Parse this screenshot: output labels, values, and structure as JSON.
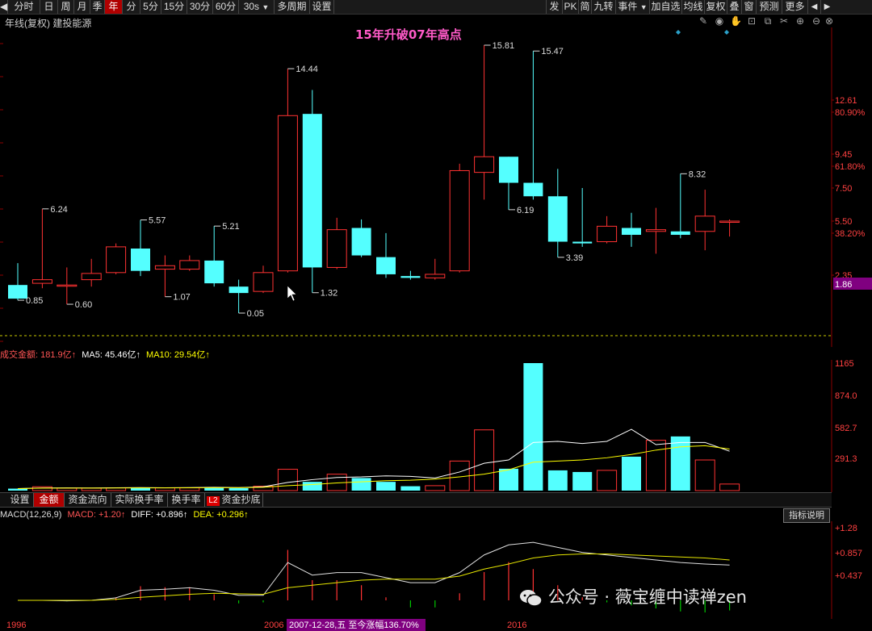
{
  "toolbar": {
    "left_items": [
      "分时",
      "日",
      "周",
      "月",
      "季",
      "年",
      "分",
      "5分",
      "15分",
      "30分",
      "60分",
      "30s",
      "多周期",
      "设置"
    ],
    "active": "年",
    "right_items": [
      "发",
      "PK",
      "简",
      "九转",
      "事件",
      "加自选",
      "均线",
      "复权",
      "叠",
      "窗",
      "预测",
      "更多"
    ]
  },
  "header": {
    "subtitle": "年线(复权) 建投能源",
    "headline": "15年升破07年高点"
  },
  "price_axis": {
    "labels": [
      "12.61",
      "80.90%",
      "9.45",
      "61.80%",
      "7.50",
      "5.50",
      "38.20%",
      "2.35",
      "1.86"
    ],
    "current": "1.86"
  },
  "chart_data": {
    "type": "candlestick",
    "candles": [
      {
        "o": 1.8,
        "c": 0.95,
        "h": 3.05,
        "l": 0.85
      },
      {
        "o": 1.9,
        "c": 2.1,
        "h": 6.24,
        "l": 1.6
      },
      {
        "o": 1.8,
        "c": 1.8,
        "h": 2.8,
        "l": 0.6
      },
      {
        "o": 2.1,
        "c": 2.45,
        "h": 3.3,
        "l": 1.7
      },
      {
        "o": 2.5,
        "c": 4.0,
        "h": 4.2,
        "l": 2.4
      },
      {
        "o": 3.9,
        "c": 2.6,
        "h": 5.57,
        "l": 2.3
      },
      {
        "o": 2.7,
        "c": 2.9,
        "h": 3.5,
        "l": 1.07
      },
      {
        "o": 2.7,
        "c": 3.2,
        "h": 3.5,
        "l": 2.6
      },
      {
        "o": 3.2,
        "c": 1.9,
        "h": 5.21,
        "l": 1.7
      },
      {
        "o": 1.7,
        "c": 1.3,
        "h": 2.1,
        "l": 0.05
      },
      {
        "o": 1.4,
        "c": 2.5,
        "h": 2.9,
        "l": 1.3
      },
      {
        "o": 2.6,
        "c": 11.7,
        "h": 14.44,
        "l": 2.5
      },
      {
        "o": 11.8,
        "c": 2.8,
        "h": 13.2,
        "l": 1.32
      },
      {
        "o": 2.8,
        "c": 5.0,
        "h": 5.7,
        "l": 2.7
      },
      {
        "o": 5.1,
        "c": 3.5,
        "h": 5.6,
        "l": 3.4
      },
      {
        "o": 3.4,
        "c": 2.4,
        "h": 4.8,
        "l": 2.2
      },
      {
        "o": 2.3,
        "c": 2.2,
        "h": 2.6,
        "l": 2.1
      },
      {
        "o": 2.2,
        "c": 2.4,
        "h": 3.3,
        "l": 2.1
      },
      {
        "o": 2.6,
        "c": 8.5,
        "h": 8.9,
        "l": 2.5
      },
      {
        "o": 8.4,
        "c": 9.3,
        "h": 15.81,
        "l": 6.8
      },
      {
        "o": 9.3,
        "c": 7.8,
        "h": 9.3,
        "l": 6.19
      },
      {
        "o": 7.8,
        "c": 7.0,
        "h": 15.47,
        "l": 6.8
      },
      {
        "o": 7.0,
        "c": 4.3,
        "h": 8.6,
        "l": 3.39
      },
      {
        "o": 4.3,
        "c": 4.2,
        "h": 7.5,
        "l": 4.0
      },
      {
        "o": 4.3,
        "c": 5.2,
        "h": 5.8,
        "l": 4.2
      },
      {
        "o": 5.1,
        "c": 4.7,
        "h": 6.0,
        "l": 4.0
      },
      {
        "o": 4.9,
        "c": 5.0,
        "h": 6.3,
        "l": 3.6
      },
      {
        "o": 4.9,
        "c": 4.7,
        "h": 8.32,
        "l": 4.5
      },
      {
        "o": 4.9,
        "c": 5.8,
        "h": 7.4,
        "l": 3.8
      },
      {
        "o": 5.5,
        "c": 5.5,
        "h": 5.6,
        "l": 4.6
      }
    ],
    "annotations": [
      "0.85",
      "6.24",
      "0.60",
      "5.57",
      "1.07",
      "5.21",
      "0.05",
      "14.44",
      "1.32",
      "15.81",
      "6.19",
      "15.47",
      "3.39",
      "8.32"
    ],
    "x_axis_labels": [
      "1996",
      "2006",
      "2016"
    ],
    "cursor_label": "2007-12-28,五 至今涨幅136.70%"
  },
  "volume": {
    "label": "成交金额: ",
    "value": "181.9亿↑",
    "ma5_label": "MA5: 45.46亿↑",
    "ma10_label": "MA10: 29.54亿↑",
    "axis_labels": [
      "1165",
      "874.0",
      "582.7",
      "291.3"
    ],
    "bars": [
      18,
      35,
      22,
      22,
      25,
      28,
      25,
      25,
      28,
      22,
      40,
      195,
      80,
      150,
      115,
      80,
      40,
      45,
      270,
      555,
      200,
      1165,
      185,
      170,
      185,
      310,
      460,
      495,
      280,
      60
    ],
    "ma5": [
      18,
      24,
      25,
      24,
      26,
      28,
      26,
      28,
      30,
      28,
      35,
      75,
      100,
      120,
      125,
      135,
      130,
      115,
      170,
      250,
      280,
      440,
      450,
      430,
      450,
      560,
      420,
      440,
      440,
      360
    ],
    "ma10": [
      18,
      22,
      23,
      23,
      24,
      25,
      25,
      26,
      27,
      27,
      30,
      45,
      55,
      70,
      80,
      90,
      95,
      105,
      125,
      150,
      190,
      260,
      270,
      280,
      300,
      330,
      370,
      400,
      410,
      380
    ]
  },
  "tabs": [
    "设置",
    "金额",
    "资金流向",
    "实际换手率",
    "换手率",
    "资金抄底"
  ],
  "active_tab": "金额",
  "l2_badge": "L2",
  "macd": {
    "label": "MACD(12,26,9)",
    "macd_text": "MACD: +1.20↑",
    "diff_text": "DIFF: +0.896↑",
    "dea_text": "DEA: +0.296↑",
    "axis_labels": [
      "+1.28",
      "+0.857",
      "+0.437"
    ],
    "explain_button": "指标说明",
    "diff": [
      0.0,
      0.0,
      -0.01,
      0.0,
      0.05,
      0.2,
      0.22,
      0.25,
      0.2,
      0.1,
      0.1,
      0.75,
      0.5,
      0.55,
      0.55,
      0.45,
      0.35,
      0.35,
      0.55,
      0.9,
      1.1,
      1.15,
      1.05,
      0.95,
      0.9,
      0.85,
      0.8,
      0.75,
      0.72,
      0.7
    ],
    "dea": [
      0.0,
      0.0,
      0.0,
      0.0,
      0.02,
      0.06,
      0.09,
      0.12,
      0.14,
      0.13,
      0.12,
      0.25,
      0.3,
      0.35,
      0.4,
      0.42,
      0.42,
      0.42,
      0.48,
      0.62,
      0.72,
      0.84,
      0.9,
      0.92,
      0.92,
      0.9,
      0.88,
      0.86,
      0.84,
      0.8
    ],
    "hist": [
      0.0,
      0.0,
      -0.02,
      0.0,
      0.06,
      0.28,
      0.26,
      0.26,
      0.12,
      -0.06,
      -0.04,
      1.0,
      0.4,
      0.4,
      0.3,
      0.06,
      -0.14,
      -0.14,
      0.14,
      0.56,
      0.76,
      0.62,
      0.3,
      0.06,
      -0.04,
      -0.1,
      -0.16,
      -0.22,
      -0.24,
      -0.2
    ]
  },
  "watermark": "公众号 · 薇宝缠中读禅zen",
  "colors": {
    "up": "#ff3232",
    "down": "#54ffff",
    "ma5": "#ffffff",
    "ma10": "#ffff00",
    "accent": "#b00000",
    "purple": "#800080"
  }
}
